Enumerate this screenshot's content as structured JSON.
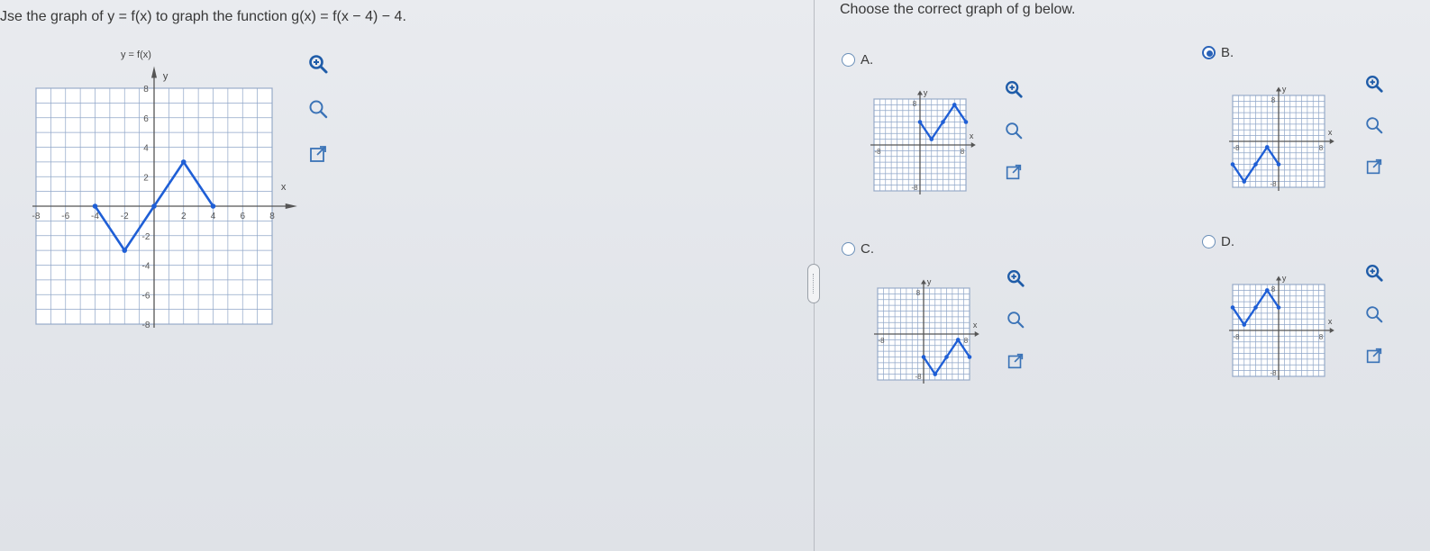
{
  "question": {
    "text": "Jse the graph of y = f(x) to graph the function g(x) = f(x − 4) − 4."
  },
  "main_graph": {
    "title": "y = f(x)",
    "x_axis_label": "x",
    "y_axis_label": "y",
    "x_range": [
      -8,
      8
    ],
    "y_range": [
      -8,
      8
    ],
    "x_tick_labels": [
      "-8",
      "-6",
      "-4",
      "-2",
      "2",
      "4",
      "6",
      "8"
    ],
    "y_tick_labels": [
      "8",
      "6",
      "4",
      "2",
      "-2",
      "-4",
      "-6",
      "-8"
    ],
    "points": [
      [
        -4,
        0
      ],
      [
        -2,
        -3
      ],
      [
        0,
        0
      ],
      [
        2,
        3
      ],
      [
        4,
        0
      ]
    ],
    "line_color": "#1f5fd6"
  },
  "answer_section": {
    "prompt": "Choose the correct graph of g below.",
    "selected": "B",
    "options": [
      {
        "letter": "A",
        "label": "A.",
        "y_tick": "8",
        "x_left_tick": "-8",
        "x_right_tick": "8",
        "y_bottom_tick": "-8",
        "x_axis_label": "x",
        "y_axis_label": "y",
        "points": [
          [
            0,
            4
          ],
          [
            2,
            1
          ],
          [
            4,
            4
          ],
          [
            6,
            7
          ],
          [
            8,
            4
          ]
        ]
      },
      {
        "letter": "B",
        "label": "B.",
        "y_tick": "8",
        "x_left_tick": "-8",
        "x_right_tick": "8",
        "y_bottom_tick": "-8",
        "x_axis_label": "x",
        "y_axis_label": "y",
        "points": [
          [
            -8,
            -4
          ],
          [
            -6,
            -7
          ],
          [
            -4,
            -4
          ],
          [
            -2,
            -1
          ],
          [
            0,
            -4
          ]
        ]
      },
      {
        "letter": "C",
        "label": "C.",
        "y_tick": "8",
        "x_left_tick": "-8",
        "x_right_tick": "8",
        "y_bottom_tick": "-8",
        "x_axis_label": "x",
        "y_axis_label": "y",
        "points": [
          [
            0,
            -4
          ],
          [
            2,
            -7
          ],
          [
            4,
            -4
          ],
          [
            6,
            -1
          ],
          [
            8,
            -4
          ]
        ]
      },
      {
        "letter": "D",
        "label": "D.",
        "y_tick": "8",
        "x_left_tick": "-8",
        "x_right_tick": "8",
        "y_bottom_tick": "-8",
        "x_axis_label": "x",
        "y_axis_label": "y",
        "points": [
          [
            -8,
            4
          ],
          [
            -6,
            1
          ],
          [
            -4,
            4
          ],
          [
            -2,
            7
          ],
          [
            0,
            4
          ]
        ]
      }
    ]
  },
  "toolbar_icons": [
    "zoom-in-icon",
    "zoom-out-icon",
    "external-link-icon"
  ],
  "colors": {
    "radio_selected": "#2a63b8",
    "grid": "#8fa6c8",
    "axis": "#555555"
  }
}
